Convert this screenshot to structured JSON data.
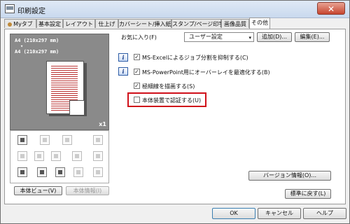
{
  "window": {
    "title": "印刷設定",
    "close_glyph": "✕"
  },
  "tabs": [
    "Myタブ",
    "基本設定",
    "レイアウト",
    "仕上げ",
    "カバーシート/挿入紙",
    "スタンプ/ページ印字",
    "画像品質",
    "その他"
  ],
  "preview": {
    "line1": "A4 (210x297 mm)",
    "arrow": "▾",
    "line2": "A4 (210x297 mm)",
    "copies": "x1"
  },
  "left_buttons": {
    "view_label": "本体ビュー(V)",
    "info_label": "本体情報(I)"
  },
  "favorites": {
    "label": "お気に入り(F)",
    "selected": "ユーザー設定",
    "arrow": "▾",
    "add_label": "追加(D)...",
    "edit_label": "編集(E)..."
  },
  "options": [
    {
      "label": "MS-Excelによるジョブ分割を抑制する(C)",
      "checked": true,
      "info_icon": true
    },
    {
      "label": "MS-PowerPoint用にオーバーレイを最適化する(B)",
      "checked": true,
      "info_icon": true
    },
    {
      "label": "極細線を描画する(S)",
      "checked": true,
      "info_icon": false
    },
    {
      "label": "本体装置で認証する(U)",
      "checked": false,
      "info_icon": false
    }
  ],
  "checkmark": "✓",
  "info_glyph": "i",
  "version_label": "バージョン情報(O)...",
  "reset_label": "標準に戻す(L)",
  "footer": {
    "ok": "OK",
    "cancel": "キャンセル",
    "help": "ヘルプ"
  },
  "accent": {
    "highlight": "#d0101a"
  }
}
